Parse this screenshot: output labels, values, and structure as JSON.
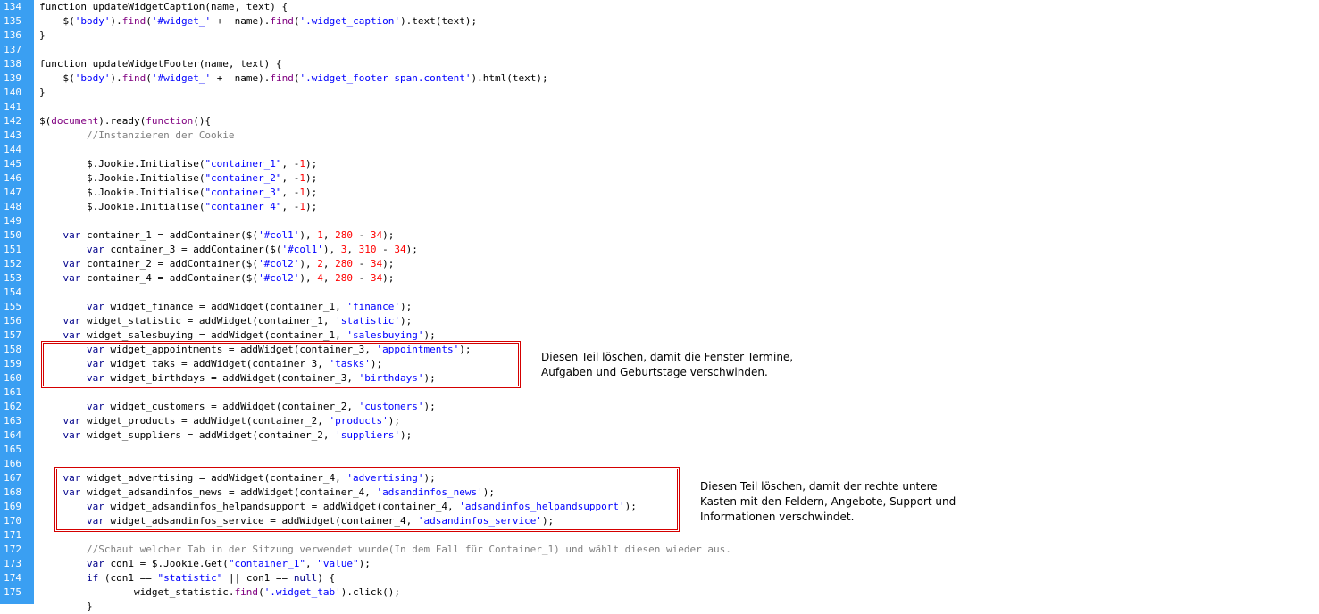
{
  "editor": {
    "lines": [
      {
        "num": "134",
        "indent": 0,
        "tokens": [
          [
            "function updateWidgetCaption(name, text) {",
            ""
          ]
        ]
      },
      {
        "num": "135",
        "indent": 4,
        "tokens": [
          [
            "$(",
            ""
          ],
          [
            "'body'",
            "str"
          ],
          [
            ").",
            ""
          ],
          [
            "find",
            "spec"
          ],
          [
            "(",
            ""
          ],
          [
            "'#widget_'",
            "str"
          ],
          [
            " +  name).",
            ""
          ],
          [
            "find",
            "spec"
          ],
          [
            "(",
            ""
          ],
          [
            "'.widget_caption'",
            "str"
          ],
          [
            ").text(text);",
            ""
          ]
        ]
      },
      {
        "num": "136",
        "indent": 0,
        "tokens": [
          [
            "}",
            ""
          ]
        ]
      },
      {
        "num": "137",
        "indent": 0,
        "tokens": []
      },
      {
        "num": "138",
        "indent": 0,
        "tokens": [
          [
            "function updateWidgetFooter(name, text) {",
            ""
          ]
        ]
      },
      {
        "num": "139",
        "indent": 4,
        "tokens": [
          [
            "$(",
            ""
          ],
          [
            "'body'",
            "str"
          ],
          [
            ").",
            ""
          ],
          [
            "find",
            "spec"
          ],
          [
            "(",
            ""
          ],
          [
            "'#widget_'",
            "str"
          ],
          [
            " +  name).",
            ""
          ],
          [
            "find",
            "spec"
          ],
          [
            "(",
            ""
          ],
          [
            "'.widget_footer span.content'",
            "str"
          ],
          [
            ").html(text);",
            ""
          ]
        ]
      },
      {
        "num": "140",
        "indent": 0,
        "tokens": [
          [
            "}",
            ""
          ]
        ]
      },
      {
        "num": "141",
        "indent": 0,
        "tokens": []
      },
      {
        "num": "142",
        "indent": 0,
        "tokens": [
          [
            "$(",
            ""
          ],
          [
            "document",
            "spec"
          ],
          [
            ").ready(",
            ""
          ],
          [
            "function",
            "spec"
          ],
          [
            "(){",
            ""
          ]
        ]
      },
      {
        "num": "143",
        "indent": 8,
        "tokens": [
          [
            "//Instanzieren der Cookie",
            "cmt"
          ]
        ]
      },
      {
        "num": "144",
        "indent": 0,
        "tokens": []
      },
      {
        "num": "145",
        "indent": 8,
        "tokens": [
          [
            "$.Jookie.Initialise(",
            ""
          ],
          [
            "\"container_1\"",
            "str"
          ],
          [
            ", -",
            ""
          ],
          [
            "1",
            "num"
          ],
          [
            ");",
            ""
          ]
        ]
      },
      {
        "num": "146",
        "indent": 8,
        "tokens": [
          [
            "$.Jookie.Initialise(",
            ""
          ],
          [
            "\"container_2\"",
            "str"
          ],
          [
            ", -",
            ""
          ],
          [
            "1",
            "num"
          ],
          [
            ");",
            ""
          ]
        ]
      },
      {
        "num": "147",
        "indent": 8,
        "tokens": [
          [
            "$.Jookie.Initialise(",
            ""
          ],
          [
            "\"container_3\"",
            "str"
          ],
          [
            ", -",
            ""
          ],
          [
            "1",
            "num"
          ],
          [
            ");",
            ""
          ]
        ]
      },
      {
        "num": "148",
        "indent": 8,
        "tokens": [
          [
            "$.Jookie.Initialise(",
            ""
          ],
          [
            "\"container_4\"",
            "str"
          ],
          [
            ", -",
            ""
          ],
          [
            "1",
            "num"
          ],
          [
            ");",
            ""
          ]
        ]
      },
      {
        "num": "149",
        "indent": 0,
        "tokens": []
      },
      {
        "num": "150",
        "indent": 4,
        "tokens": [
          [
            "var",
            "kw"
          ],
          [
            " container_1 = addContainer($(",
            ""
          ],
          [
            "'#col1'",
            "str"
          ],
          [
            "), ",
            ""
          ],
          [
            "1",
            "num"
          ],
          [
            ", ",
            ""
          ],
          [
            "280",
            "num"
          ],
          [
            " - ",
            ""
          ],
          [
            "34",
            "num"
          ],
          [
            ");",
            ""
          ]
        ]
      },
      {
        "num": "151",
        "indent": 8,
        "tokens": [
          [
            "var",
            "kw"
          ],
          [
            " container_3 = addContainer($(",
            ""
          ],
          [
            "'#col1'",
            "str"
          ],
          [
            "), ",
            ""
          ],
          [
            "3",
            "num"
          ],
          [
            ", ",
            ""
          ],
          [
            "310",
            "num"
          ],
          [
            " - ",
            ""
          ],
          [
            "34",
            "num"
          ],
          [
            ");",
            ""
          ]
        ]
      },
      {
        "num": "152",
        "indent": 4,
        "tokens": [
          [
            "var",
            "kw"
          ],
          [
            " container_2 = addContainer($(",
            ""
          ],
          [
            "'#col2'",
            "str"
          ],
          [
            "), ",
            ""
          ],
          [
            "2",
            "num"
          ],
          [
            ", ",
            ""
          ],
          [
            "280",
            "num"
          ],
          [
            " - ",
            ""
          ],
          [
            "34",
            "num"
          ],
          [
            ");",
            ""
          ]
        ]
      },
      {
        "num": "153",
        "indent": 4,
        "tokens": [
          [
            "var",
            "kw"
          ],
          [
            " container_4 = addContainer($(",
            ""
          ],
          [
            "'#col2'",
            "str"
          ],
          [
            "), ",
            ""
          ],
          [
            "4",
            "num"
          ],
          [
            ", ",
            ""
          ],
          [
            "280",
            "num"
          ],
          [
            " - ",
            ""
          ],
          [
            "34",
            "num"
          ],
          [
            ");",
            ""
          ]
        ]
      },
      {
        "num": "154",
        "indent": 0,
        "tokens": []
      },
      {
        "num": "155",
        "indent": 8,
        "tokens": [
          [
            "var",
            "kw"
          ],
          [
            " widget_finance = addWidget(container_1, ",
            ""
          ],
          [
            "'finance'",
            "str"
          ],
          [
            ");",
            ""
          ]
        ]
      },
      {
        "num": "156",
        "indent": 4,
        "tokens": [
          [
            "var",
            "kw"
          ],
          [
            " widget_statistic = addWidget(container_1, ",
            ""
          ],
          [
            "'statistic'",
            "str"
          ],
          [
            ");",
            ""
          ]
        ]
      },
      {
        "num": "157",
        "indent": 4,
        "tokens": [
          [
            "var",
            "kw"
          ],
          [
            " widget_salesbuying = addWidget(container_1, ",
            ""
          ],
          [
            "'salesbuying'",
            "str"
          ],
          [
            ");",
            ""
          ]
        ]
      },
      {
        "num": "158",
        "indent": 8,
        "tokens": [
          [
            "var",
            "kw"
          ],
          [
            " widget_appointments = addWidget(container_3, ",
            ""
          ],
          [
            "'appointments'",
            "str"
          ],
          [
            ");",
            ""
          ]
        ]
      },
      {
        "num": "159",
        "indent": 8,
        "tokens": [
          [
            "var",
            "kw"
          ],
          [
            " widget_taks = addWidget(container_3, ",
            ""
          ],
          [
            "'tasks'",
            "str"
          ],
          [
            ");",
            ""
          ]
        ]
      },
      {
        "num": "160",
        "indent": 8,
        "tokens": [
          [
            "var",
            "kw"
          ],
          [
            " widget_birthdays = addWidget(container_3, ",
            ""
          ],
          [
            "'birthdays'",
            "str"
          ],
          [
            ");",
            ""
          ]
        ]
      },
      {
        "num": "161",
        "indent": 0,
        "tokens": []
      },
      {
        "num": "162",
        "indent": 8,
        "tokens": [
          [
            "var",
            "kw"
          ],
          [
            " widget_customers = addWidget(container_2, ",
            ""
          ],
          [
            "'customers'",
            "str"
          ],
          [
            ");",
            ""
          ]
        ]
      },
      {
        "num": "163",
        "indent": 4,
        "tokens": [
          [
            "var",
            "kw"
          ],
          [
            " widget_products = addWidget(container_2, ",
            ""
          ],
          [
            "'products'",
            "str"
          ],
          [
            ");",
            ""
          ]
        ]
      },
      {
        "num": "164",
        "indent": 4,
        "tokens": [
          [
            "var",
            "kw"
          ],
          [
            " widget_suppliers = addWidget(container_2, ",
            ""
          ],
          [
            "'suppliers'",
            "str"
          ],
          [
            ");",
            ""
          ]
        ]
      },
      {
        "num": "165",
        "indent": 0,
        "tokens": []
      },
      {
        "num": "166",
        "indent": 0,
        "tokens": []
      },
      {
        "num": "167",
        "indent": 4,
        "tokens": [
          [
            "var",
            "kw"
          ],
          [
            " widget_advertising = addWidget(container_4, ",
            ""
          ],
          [
            "'advertising'",
            "str"
          ],
          [
            ");",
            ""
          ]
        ]
      },
      {
        "num": "168",
        "indent": 4,
        "tokens": [
          [
            "var",
            "kw"
          ],
          [
            " widget_adsandinfos_news = addWidget(container_4, ",
            ""
          ],
          [
            "'adsandinfos_news'",
            "str"
          ],
          [
            ");",
            ""
          ]
        ]
      },
      {
        "num": "169",
        "indent": 8,
        "tokens": [
          [
            "var",
            "kw"
          ],
          [
            " widget_adsandinfos_helpandsupport = addWidget(container_4, ",
            ""
          ],
          [
            "'adsandinfos_helpandsupport'",
            "str"
          ],
          [
            ");",
            ""
          ]
        ]
      },
      {
        "num": "170",
        "indent": 8,
        "tokens": [
          [
            "var",
            "kw"
          ],
          [
            " widget_adsandinfos_service = addWidget(container_4, ",
            ""
          ],
          [
            "'adsandinfos_service'",
            "str"
          ],
          [
            ");",
            ""
          ]
        ]
      },
      {
        "num": "171",
        "indent": 0,
        "tokens": []
      },
      {
        "num": "172",
        "indent": 8,
        "tokens": [
          [
            "//Schaut welcher Tab in der Sitzung verwendet wurde(In dem Fall für Container_1) und wählt diesen wieder aus.",
            "cmt"
          ]
        ]
      },
      {
        "num": "173",
        "indent": 8,
        "tokens": [
          [
            "var",
            "kw"
          ],
          [
            " con1 = $.Jookie.Get(",
            ""
          ],
          [
            "\"container_1\"",
            "str"
          ],
          [
            ", ",
            ""
          ],
          [
            "\"value\"",
            "str"
          ],
          [
            ");",
            ""
          ]
        ]
      },
      {
        "num": "174",
        "indent": 8,
        "tokens": [
          [
            "if",
            "kw"
          ],
          [
            " (con1 == ",
            ""
          ],
          [
            "\"statistic\"",
            "str"
          ],
          [
            " || con1 == ",
            ""
          ],
          [
            "null",
            "kw"
          ],
          [
            ") {",
            ""
          ]
        ]
      },
      {
        "num": "175",
        "indent": 16,
        "tokens": [
          [
            "widget_statistic.",
            ""
          ],
          [
            "find",
            "spec"
          ],
          [
            "(",
            ""
          ],
          [
            "'.widget_tab'",
            "str"
          ],
          [
            ").click();",
            ""
          ]
        ]
      },
      {
        "num": "",
        "indent": 8,
        "tokens": [
          [
            "}",
            ""
          ]
        ]
      }
    ]
  },
  "annotations": [
    {
      "lines": [
        "Diesen Teil löschen, damit die Fenster Termine,",
        "Aufgaben und Geburtstage verschwinden."
      ]
    },
    {
      "lines": [
        "Diesen Teil löschen, damit der rechte untere",
        "Kasten mit den Feldern, Angebote, Support und",
        "Informationen verschwindet."
      ]
    }
  ],
  "colors": {
    "gutter": "#3a9ff2",
    "keyword": "#00008b",
    "string": "#0000ff",
    "number": "#ff0000",
    "comment": "#808080",
    "builtin": "#800080",
    "highlight_box": "#d40000"
  }
}
